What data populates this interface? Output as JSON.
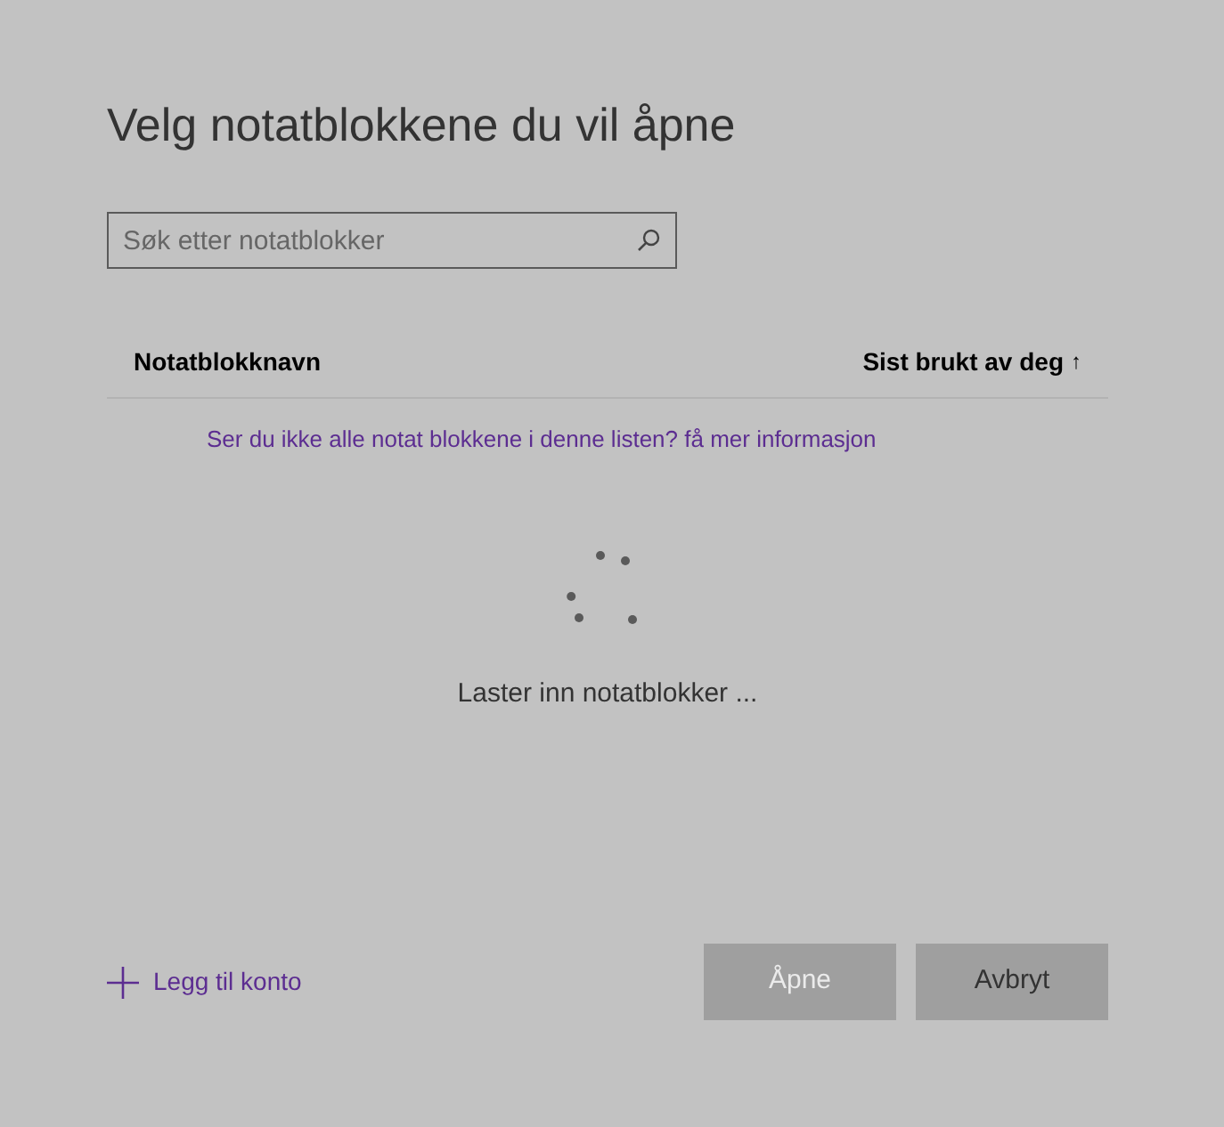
{
  "title": "Velg notatblokkene du vil åpne",
  "search": {
    "placeholder": "Søk etter notatblokker"
  },
  "columns": [
    {
      "label": "Notatblokknavn"
    },
    {
      "label": "Sist brukt av deg",
      "sort": "↑"
    }
  ],
  "info_link": "Ser du ikke alle notat blokkene i denne listen? få mer informasjon",
  "loading_text": "Laster inn notatblokker ...",
  "add_account": "Legg til konto",
  "buttons": [
    {
      "label": "Åpne",
      "disabled": true
    },
    {
      "label": "Avbryt",
      "disabled": false
    }
  ]
}
